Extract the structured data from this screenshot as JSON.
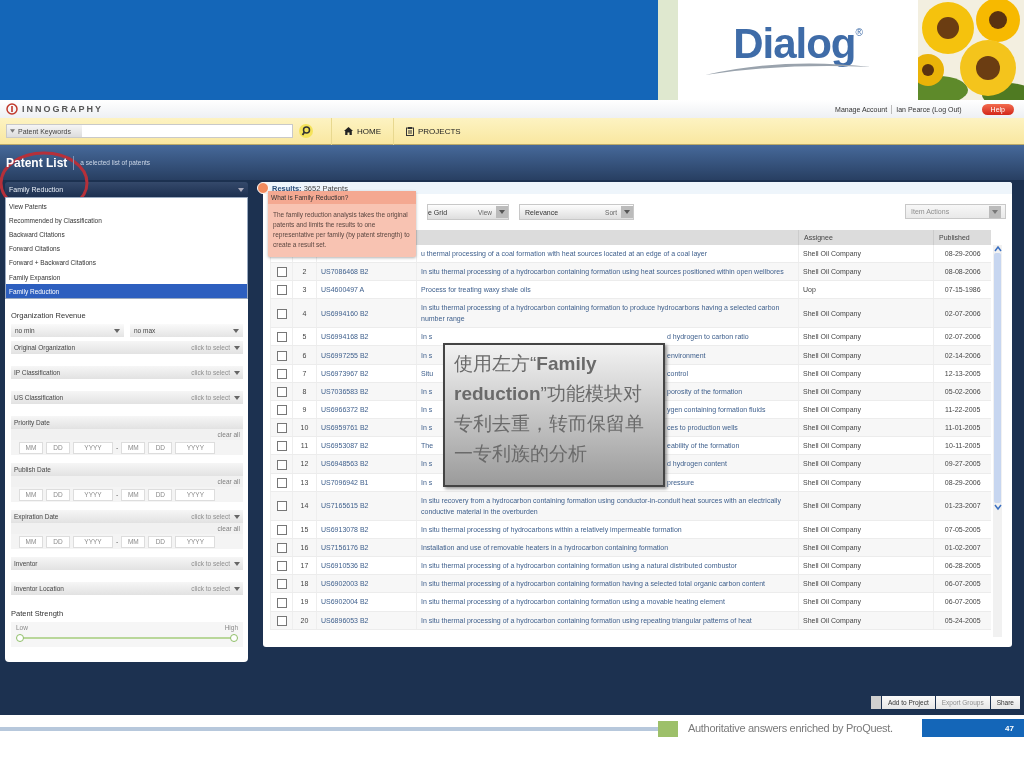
{
  "slide": {
    "brand": "Dialog",
    "brand_mark": "®",
    "tagline": "Authoritative answers enriched by ProQuest.",
    "page_number": "47"
  },
  "app_header": {
    "logo": "INNOGRAPHY",
    "links": [
      "Manage Account",
      "Ian Pearce (Log Out)"
    ],
    "help": "Help"
  },
  "search_bar": {
    "scope": "Patent Keywords",
    "nav": [
      {
        "kind": "home",
        "label": "HOME"
      },
      {
        "kind": "projects",
        "label": "PROJECTS"
      }
    ]
  },
  "page_title": {
    "title": "Patent List",
    "subtitle": "a selected list of patents"
  },
  "analysis_select": {
    "value": "Family Reduction",
    "expanded": true,
    "options": [
      {
        "label": "View Patents",
        "selected": false
      },
      {
        "label": "Recommended by Classification",
        "selected": false
      },
      {
        "label": "Backward Citations",
        "selected": false
      },
      {
        "label": "Forward Citations",
        "selected": false
      },
      {
        "label": "Forward + Backward Citations",
        "selected": false
      },
      {
        "label": "Family Expansion",
        "selected": false
      },
      {
        "label": "Family Reduction",
        "selected": true
      }
    ]
  },
  "filters": [
    {
      "kind": "range",
      "label": "Organization Revenue",
      "min": "no min",
      "max": "no max"
    },
    {
      "kind": "select",
      "label": "Original Organization",
      "hint": "click to select"
    },
    {
      "kind": "select",
      "label": "IP Classification",
      "hint": "click to select"
    },
    {
      "kind": "select",
      "label": "US Classification",
      "hint": "click to select"
    },
    {
      "kind": "date",
      "label": "Priority Date",
      "clear": "clear all",
      "placeholders": [
        "MM",
        "DD",
        "YYYY",
        "MM",
        "DD",
        "YYYY"
      ],
      "separator": "-"
    },
    {
      "kind": "date",
      "label": "Publish Date",
      "clear": "clear all",
      "placeholders": [
        "MM",
        "DD",
        "YYYY",
        "MM",
        "DD",
        "YYYY"
      ],
      "separator": "-"
    },
    {
      "kind": "date",
      "label": "Expiration Date",
      "hint": "click to select",
      "clear": "clear all",
      "placeholders": [
        "MM",
        "DD",
        "YYYY",
        "MM",
        "DD",
        "YYYY"
      ],
      "separator": "-"
    },
    {
      "kind": "select",
      "label": "Inventor",
      "hint": "click to select"
    },
    {
      "kind": "select",
      "label": "Inventor Location",
      "hint": "click to select"
    },
    {
      "kind": "slider",
      "label": "Patent Strength",
      "low": "Low",
      "high": "High",
      "thumbs": [
        {
          "level": 0
        },
        {
          "level": 1
        }
      ]
    }
  ],
  "results": {
    "label": "Results:",
    "count": "3652 Patents",
    "tooltip": {
      "title": "What is Family Reduction?",
      "body": "The family reduction analysis takes the original patents and limits the results to one representative per family (by patent strength) to create a result set."
    },
    "toolbar": {
      "view": {
        "value": "e Grid",
        "caption": "View"
      },
      "sort": {
        "value": "Relevance",
        "caption": "Sort"
      },
      "actions": {
        "placeholder": "Item Actions",
        "disabled": true
      }
    },
    "columns": [
      "Assignee",
      "Published"
    ],
    "rows": [
      {
        "title": "u thermal processing of a coal formation with heat sources located at an edge of a coal layer",
        "assignee": "Shell Oil Company",
        "published": "08-29-2006"
      },
      {
        "n": "2",
        "id": "US7086468 B2",
        "checked": false,
        "title": "In situ thermal processing of a hydrocarbon containing formation using heat sources positioned within open wellbores",
        "assignee": "Shell Oil Company",
        "published": "08-08-2006"
      },
      {
        "n": "3",
        "id": "US4600497 A",
        "checked": false,
        "title": "Process for treating waxy shale oils",
        "assignee": "Uop",
        "published": "07-15-1986"
      },
      {
        "n": "4",
        "id": "US6994160 B2",
        "checked": false,
        "title": "In situ thermal processing of a hydrocarbon containing formation to produce hydrocarbons having a selected carbon number range",
        "assignee": "Shell Oil Company",
        "published": "02-07-2006"
      },
      {
        "n": "5",
        "id": "US6994168 B2",
        "checked": false,
        "title": "In s",
        "title_end": "d hydrogen to carbon ratio",
        "assignee": "Shell Oil Company",
        "published": "02-07-2006"
      },
      {
        "n": "6",
        "id": "US6997255 B2",
        "checked": false,
        "title": "In s",
        "title_end": "environment",
        "assignee": "Shell Oil Company",
        "published": "02-14-2006"
      },
      {
        "n": "7",
        "id": "US6973967 B2",
        "checked": false,
        "title": "Situ",
        "title_end": "control",
        "assignee": "Shell Oil Company",
        "published": "12-13-2005"
      },
      {
        "n": "8",
        "id": "US7036583 B2",
        "checked": false,
        "title": "In s",
        "title_end": "porosity of the formation",
        "assignee": "Shell Oil Company",
        "published": "05-02-2006"
      },
      {
        "n": "9",
        "id": "US6966372 B2",
        "checked": false,
        "title": "In s",
        "title_end": "ygen containing formation fluids",
        "assignee": "Shell Oil Company",
        "published": "11-22-2005"
      },
      {
        "n": "10",
        "id": "US6959761 B2",
        "checked": false,
        "title": "In s",
        "title_end": "ces to production wells",
        "assignee": "Shell Oil Company",
        "published": "11-01-2005"
      },
      {
        "n": "11",
        "id": "US6953087 B2",
        "checked": false,
        "title": "The",
        "title_end": "eability of the formation",
        "assignee": "Shell Oil Company",
        "published": "10-11-2005"
      },
      {
        "n": "12",
        "id": "US6948563 B2",
        "checked": false,
        "title": "In s",
        "title_end": "d hydrogen content",
        "assignee": "Shell Oil Company",
        "published": "09-27-2005"
      },
      {
        "n": "13",
        "id": "US7096942 B1",
        "checked": false,
        "title": "In s",
        "title_end": "pressure",
        "assignee": "Shell Oil Company",
        "published": "08-29-2006"
      },
      {
        "n": "14",
        "id": "US7165615 B2",
        "checked": false,
        "title": "In situ recovery from a hydrocarbon containing formation using conductor-in-conduit heat sources with an electrically conductive material in the overburden",
        "assignee": "Shell Oil Company",
        "published": "01-23-2007"
      },
      {
        "n": "15",
        "id": "US6913078 B2",
        "checked": false,
        "title": "In situ thermal processing of hydrocarbons within a relatively impermeable formation",
        "assignee": "Shell Oil Company",
        "published": "07-05-2005"
      },
      {
        "n": "16",
        "id": "US7156176 B2",
        "checked": false,
        "title": "Installation and use of removable heaters in a hydrocarbon containing formation",
        "assignee": "Shell Oil Company",
        "published": "01-02-2007"
      },
      {
        "n": "17",
        "id": "US6910536 B2",
        "checked": false,
        "title": "In situ thermal processing of a hydrocarbon containing formation using a natural distributed combustor",
        "assignee": "Shell Oil Company",
        "published": "06-28-2005"
      },
      {
        "n": "18",
        "id": "US6902003 B2",
        "checked": false,
        "title": "In situ thermal processing of a hydrocarbon containing formation having a selected total organic carbon content",
        "assignee": "Shell Oil Company",
        "published": "06-07-2005"
      },
      {
        "n": "19",
        "id": "US6902004 B2",
        "checked": false,
        "title": "In situ thermal processing of a hydrocarbon containing formation using a movable heating element",
        "assignee": "Shell Oil Company",
        "published": "06-07-2005"
      },
      {
        "n": "20",
        "id": "US6896053 B2",
        "checked": false,
        "title": "In situ thermal processing of a hydrocarbon containing formation using repeating triangular patterns of heat",
        "assignee": "Shell Oil Company",
        "published": "05-24-2005"
      }
    ]
  },
  "callout": {
    "text": "使用左方“**Family reduction**”功能模块对专利去重，转而保留单一专利族的分析"
  },
  "actions": [
    {
      "label": "Add to Project",
      "disabled": false
    },
    {
      "label": "Export Groups",
      "disabled": true
    },
    {
      "label": "Share",
      "disabled": false
    }
  ]
}
